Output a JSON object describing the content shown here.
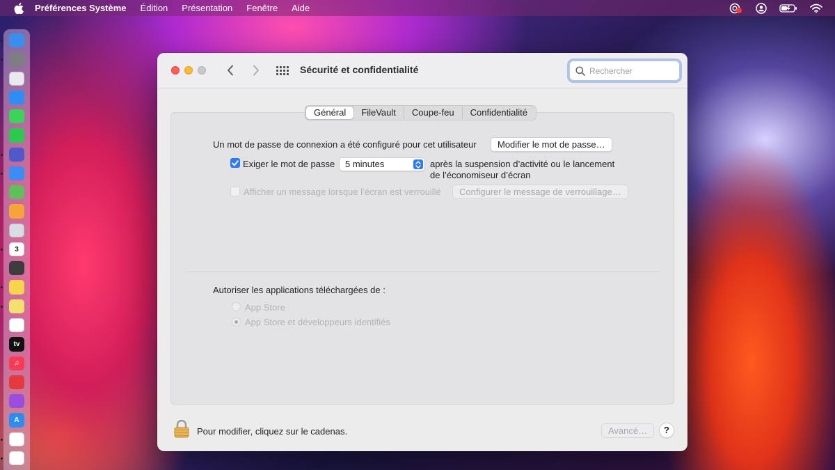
{
  "menubar": {
    "apple_icon": "apple-logo",
    "items": [
      "Préférences Système",
      "Édition",
      "Présentation",
      "Fenêtre",
      "Aide"
    ],
    "status_icons": [
      "screen-recording-icon",
      "user-icon",
      "battery-icon",
      "wifi-icon"
    ]
  },
  "dock": {
    "apps": [
      {
        "name": "finder",
        "color": "#3a8ef0",
        "label": ""
      },
      {
        "name": "system-preferences",
        "color": "#7d7d82",
        "label": ""
      },
      {
        "name": "launchpad",
        "color": "#e9e9ee",
        "label": ""
      },
      {
        "name": "safari",
        "color": "#2f8df6",
        "label": ""
      },
      {
        "name": "messages",
        "color": "#3cd35a",
        "label": ""
      },
      {
        "name": "facetime",
        "color": "#2fc84f",
        "label": ""
      },
      {
        "name": "teams",
        "color": "#5059c9",
        "label": ""
      },
      {
        "name": "mail",
        "color": "#3b8df5",
        "label": ""
      },
      {
        "name": "maps",
        "color": "#5fbf5a",
        "label": ""
      },
      {
        "name": "photos",
        "color": "#f5a33b",
        "label": ""
      },
      {
        "name": "preview",
        "color": "#d8dce3",
        "label": ""
      },
      {
        "name": "calendar",
        "color": "#ffffff",
        "label": "3"
      },
      {
        "name": "calculator",
        "color": "#3c3c3f",
        "label": ""
      },
      {
        "name": "notes",
        "color": "#f7d54a",
        "label": ""
      },
      {
        "name": "stickies",
        "color": "#f4e06c",
        "label": ""
      },
      {
        "name": "reminders",
        "color": "#ffffff",
        "label": ""
      },
      {
        "name": "apple-tv",
        "color": "#111111",
        "label": "tv"
      },
      {
        "name": "music",
        "color": "#fa3a55",
        "label": "♫"
      },
      {
        "name": "creative-cloud",
        "color": "#e5393f",
        "label": ""
      },
      {
        "name": "podcasts",
        "color": "#9b4de0",
        "label": ""
      },
      {
        "name": "app-store",
        "color": "#2d8cf2",
        "label": "A"
      },
      {
        "name": "chrome",
        "color": "#ffffff",
        "label": ""
      },
      {
        "name": "monday",
        "color": "#ffffff",
        "label": ""
      }
    ]
  },
  "window": {
    "title": "Sécurité et confidentialité",
    "search_placeholder": "Rechercher",
    "tabs": [
      {
        "label": "Général",
        "active": true
      },
      {
        "label": "FileVault",
        "active": false
      },
      {
        "label": "Coupe-feu",
        "active": false
      },
      {
        "label": "Confidentialité",
        "active": false
      }
    ],
    "general": {
      "password_text": "Un mot de passe de connexion a été configuré pour cet utilisateur",
      "change_password_button": "Modifier le mot de passe…",
      "require_password_label": "Exiger le mot de passe",
      "require_password_checked": true,
      "require_password_delay": "5 minutes",
      "require_password_suffix_line1": "après la suspension d’activité ou le lancement",
      "require_password_suffix_line2": "de l’économiseur d’écran",
      "show_message_label": "Afficher un message lorsque l’écran est verrouillé",
      "show_message_checked": false,
      "configure_message_button": "Configurer le message de verrouillage…",
      "allow_apps_heading": "Autoriser les applications téléchargées de :",
      "allow_options": [
        {
          "label": "App Store",
          "selected": false
        },
        {
          "label": "App Store et développeurs identifiés",
          "selected": true
        }
      ]
    },
    "footer": {
      "lock_text": "Pour modifier, cliquez sur le cadenas.",
      "advanced_button": "Avancé…",
      "help_button": "?"
    }
  },
  "colors": {
    "accent": "#2f7bf5",
    "close": "#ff5f57",
    "minimize": "#febc2e"
  }
}
